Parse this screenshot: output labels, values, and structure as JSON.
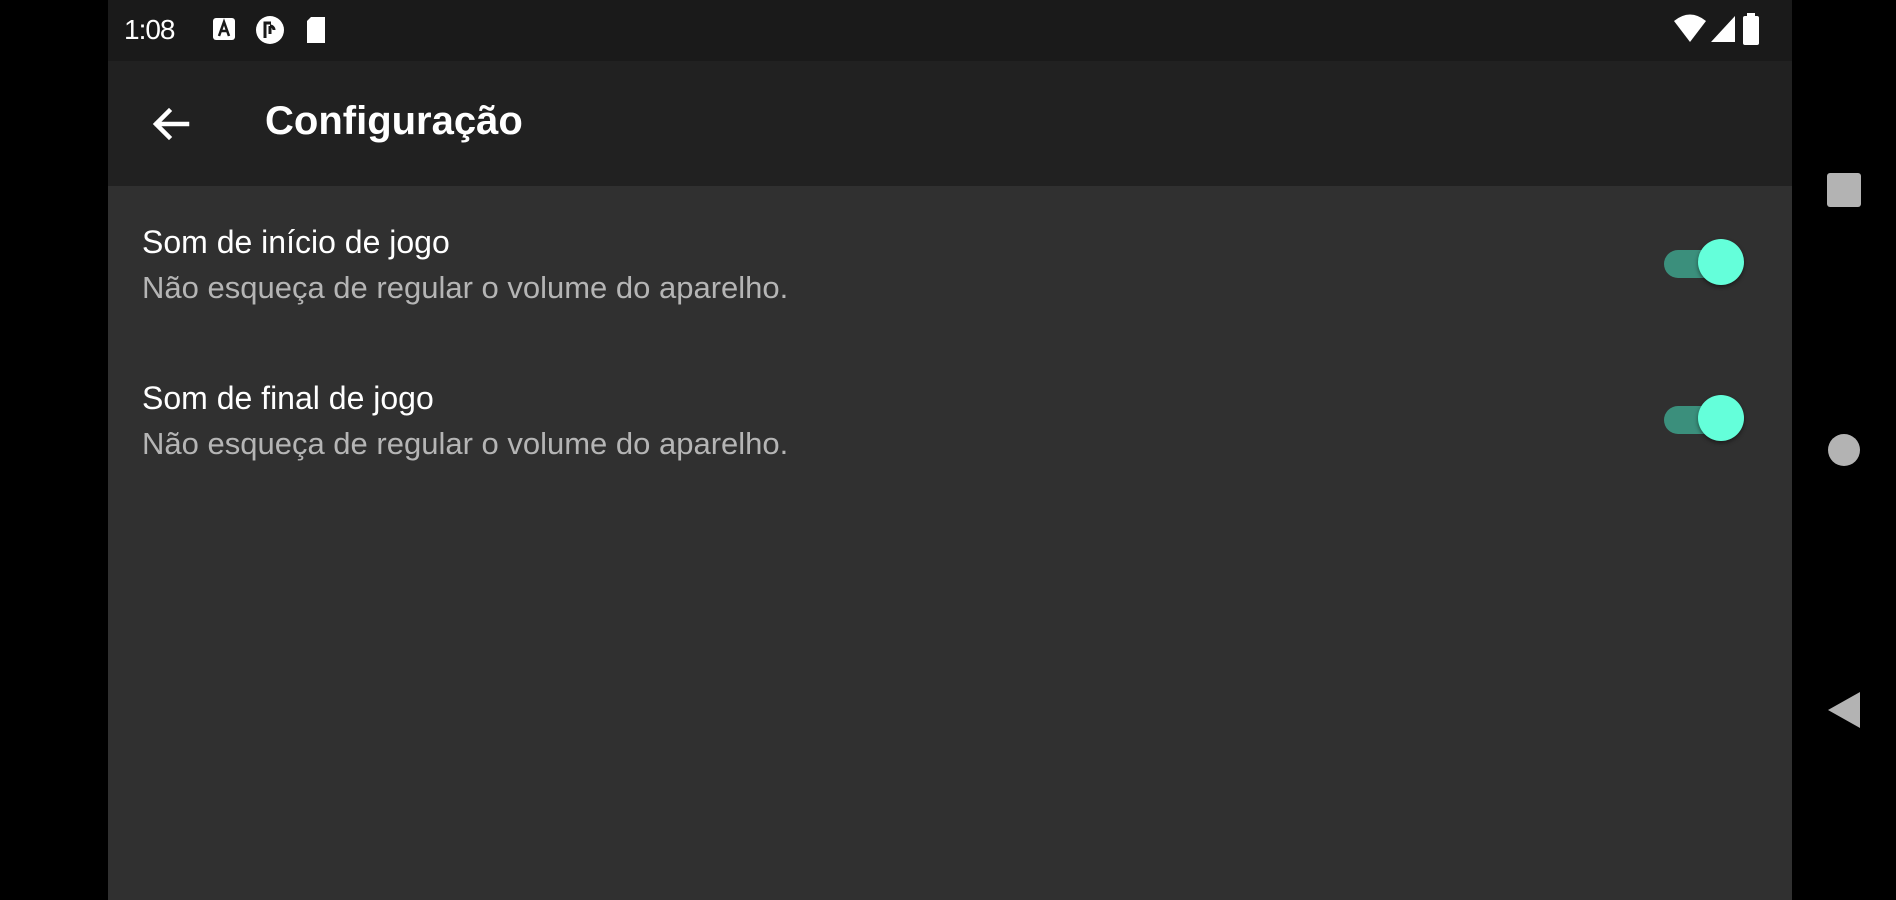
{
  "status_bar": {
    "time": "1:08",
    "icons": [
      "font-a-icon",
      "app-notification-icon",
      "sd-card-icon",
      "wifi-icon",
      "cell-signal-icon",
      "battery-icon"
    ]
  },
  "app_bar": {
    "back_icon": "arrow-left-icon",
    "title": "Configuração"
  },
  "settings": [
    {
      "title": "Som de início de jogo",
      "summary": "Não esqueça de regular o volume do aparelho.",
      "enabled": true
    },
    {
      "title": "Som de final de jogo",
      "summary": "Não esqueça de regular o volume do aparelho.",
      "enabled": true
    }
  ],
  "navigation": {
    "buttons": [
      "recents-icon",
      "home-icon",
      "back-icon"
    ]
  },
  "colors": {
    "background": "#303030",
    "app_bar": "#212121",
    "status_bar": "#1a1a1a",
    "switch_thumb": "#64ffda",
    "switch_track": "#3b8f7c",
    "summary_text": "#b5b5b5"
  }
}
